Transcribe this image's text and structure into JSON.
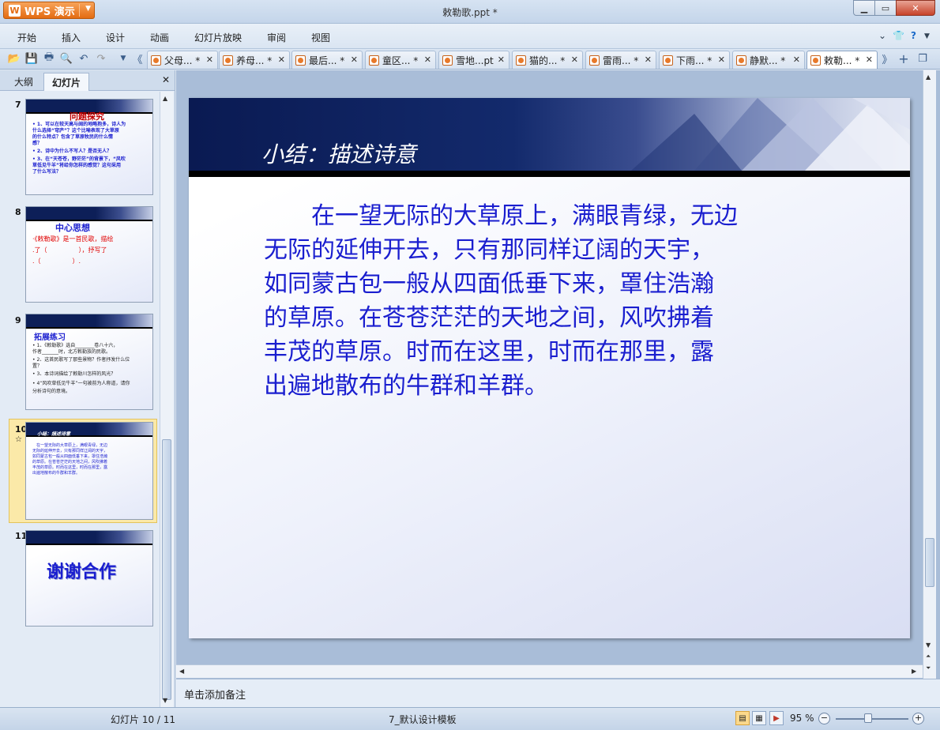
{
  "window": {
    "app_button": "WPS 演示",
    "title": "敕勒歌.ppt *"
  },
  "menu": [
    "开始",
    "插入",
    "设计",
    "动画",
    "幻灯片放映",
    "审阅",
    "视图"
  ],
  "tabs": [
    {
      "label": "父母... *"
    },
    {
      "label": "养母... *"
    },
    {
      "label": "最后... *"
    },
    {
      "label": "童区... *"
    },
    {
      "label": "雪地...pt"
    },
    {
      "label": "猫的... *"
    },
    {
      "label": "雷雨... *"
    },
    {
      "label": "下雨... *"
    },
    {
      "label": "静默... *"
    },
    {
      "label": "敕勒... *"
    }
  ],
  "left_panel": {
    "tab_outline": "大纲",
    "tab_slides": "幻灯片",
    "slides": [
      {
        "num": "7",
        "title": "问题探究",
        "lines": [
          "• 1、可以在较天高与阔的地略抱多，诗人为",
          "  什么选择“穹庐”？这个比喻表现了大草原",
          "  的什么特点？包含了草原牧民的什么情",
          "  感？",
          "• 2、诗中为什么不写人？是否无人？",
          "• 3、在“天苍苍，野茫茫”的背景下，“风吹",
          "  草低见牛羊”将给你怎样的感觉？这句采用",
          "  了什么写法？"
        ]
      },
      {
        "num": "8",
        "title": "中心思想",
        "lines": [
          "·《敕勒歌》是一首民歌，描绘",
          ".了（　　　　　），抒写了",
          ".（　　　　　）."
        ]
      },
      {
        "num": "9",
        "title": "拓展练习",
        "lines": [
          "• 1、《敕勒歌》选自________卷八十六，",
          "  作者_______时，北方敕勒族的民歌。",
          "• 2、这首民歌写了那些景物？作者抒发什么位",
          "  置？",
          "• 3、本诗词描绘了敕勒川怎样的风光？",
          "• 4“风吹草低见牛羊”一句被前为人称道，请你",
          "  分析诗句的意境。"
        ]
      },
      {
        "num": "10",
        "title": "小结：描述诗意",
        "lines": [
          "　在一望无际的大草原上，满眼青绿，无边",
          "无际的延伸开去，只有那同样辽阔的天宇，",
          "如同蒙古包一般从四面低垂下来，罩住浩瀚",
          "的草原。在苍苍茫茫的天地之间，风吹拂着",
          "丰茂的草原。时而在这里，时而在那里，露",
          "出遍地散布的牛群和羊群。"
        ]
      },
      {
        "num": "11",
        "title": "谢谢合作",
        "lines": []
      }
    ]
  },
  "slide": {
    "title": "小结：描述诗意",
    "body_lines": [
      "　　在一望无际的大草原上，满眼青绿，无边",
      "无际的延伸开去，只有那同样辽阔的天宇，",
      "如同蒙古包一般从四面低垂下来，罩住浩瀚",
      "的草原。在苍苍茫茫的天地之间，风吹拂着",
      "丰茂的草原。时而在这里，时而在那里，露",
      "出遍地散布的牛群和羊群。"
    ]
  },
  "notes_placeholder": "单击添加备注",
  "status": {
    "slide_counter": "幻灯片 10 / 11",
    "template": "7_默认设计模板",
    "zoom": "95 %"
  },
  "colors": {
    "slide_text": "#1a1ecf",
    "title_band": "#0a1a52",
    "wps_orange": "#e46c12"
  }
}
